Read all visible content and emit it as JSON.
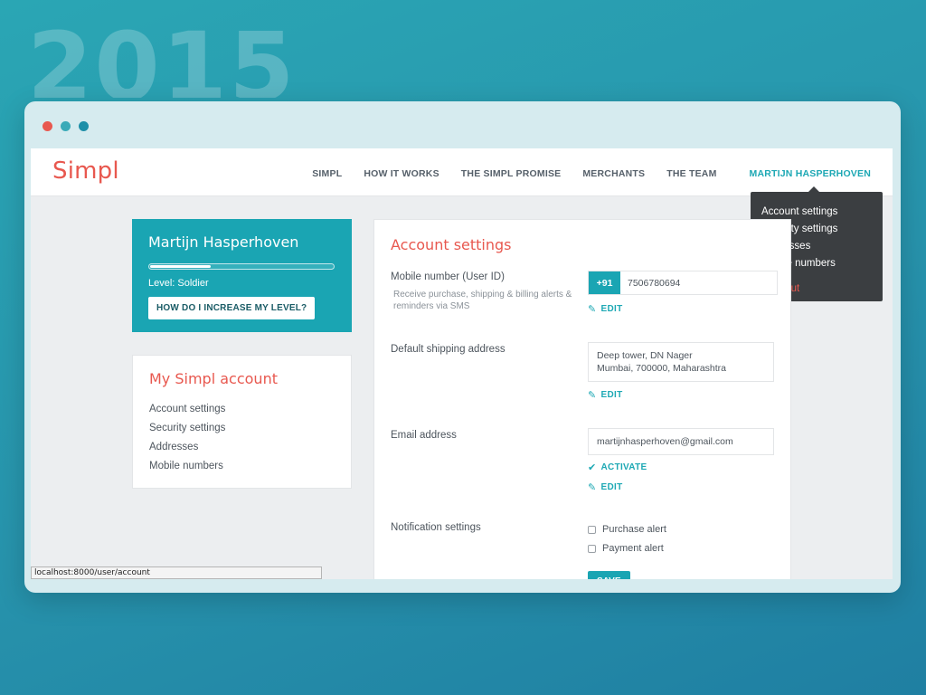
{
  "year": "2015",
  "window_dots": [
    "#e8584f",
    "#3aaab8",
    "#1e8fa8"
  ],
  "brand": {
    "logo": "Simpl",
    "accent": "#e8584f",
    "teal": "#1aa5b3"
  },
  "nav": {
    "items": [
      "SIMPL",
      "HOW IT WORKS",
      "THE SIMPL PROMISE",
      "MERCHANTS",
      "THE TEAM"
    ],
    "user": "MARTIJN HASPERHOVEN"
  },
  "dropdown": {
    "items": [
      "Account settings",
      "Security settings",
      "Addresses",
      "Mobile numbers"
    ],
    "signout": "Sign out"
  },
  "profile": {
    "name": "Martijn Hasperhoven",
    "progress_percent": 33,
    "level": "Level: Soldier",
    "button": "HOW DO I INCREASE MY LEVEL?"
  },
  "my_account": {
    "title": "My Simpl account",
    "links": [
      "Account settings",
      "Security settings",
      "Addresses",
      "Mobile numbers"
    ]
  },
  "settings": {
    "title": "Account settings",
    "mobile": {
      "label": "Mobile number (User ID)",
      "hint": "Receive purchase, shipping & billing alerts & reminders via SMS",
      "code": "+91",
      "number": "7506780694",
      "edit": "EDIT"
    },
    "shipping": {
      "label": "Default shipping address",
      "line1": "Deep tower, DN Nager",
      "line2": "Mumbai, 700000, Maharashtra",
      "edit": "EDIT"
    },
    "email": {
      "label": "Email address",
      "value": "martijnhasperhoven@gmail.com",
      "activate": "ACTIVATE",
      "edit": "EDIT"
    },
    "notifications": {
      "label": "Notification settings",
      "options": [
        "Purchase alert",
        "Payment alert"
      ],
      "save": "SAVE"
    }
  },
  "status_url": "localhost:8000/user/account"
}
